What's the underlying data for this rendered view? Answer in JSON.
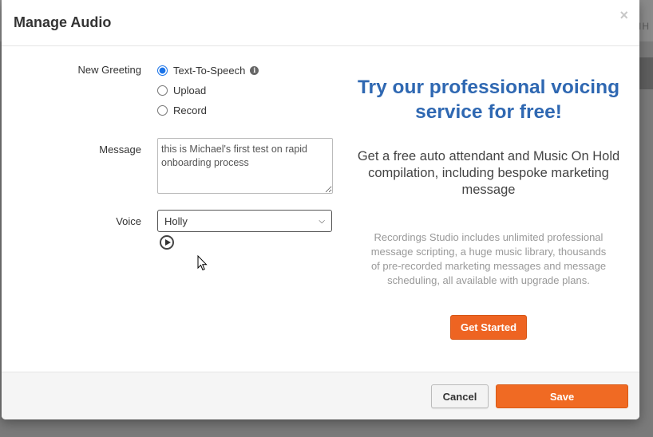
{
  "background": {
    "partial_text": "IH"
  },
  "modal": {
    "title": "Manage Audio",
    "close_glyph": "×"
  },
  "form": {
    "new_greeting_label": "New Greeting",
    "options": [
      {
        "label": "Text-To-Speech",
        "selected": true
      },
      {
        "label": "Upload",
        "selected": false
      },
      {
        "label": "Record",
        "selected": false
      }
    ],
    "info_glyph": "i",
    "message_label": "Message",
    "message_value": "this is Michael's first test on rapid onboarding process",
    "voice_label": "Voice",
    "voice_selected": "Holly"
  },
  "promo": {
    "title": "Try our professional voicing service for free!",
    "subtitle": "Get a free auto attendant and Music On Hold compilation, including bespoke marketing message",
    "description": "Recordings Studio includes unlimited professional message scripting, a huge music library, thousands of pre-recorded marketing messages and message scheduling, all available with upgrade plans.",
    "cta_label": "Get Started"
  },
  "footer": {
    "cancel_label": "Cancel",
    "save_label": "Save"
  },
  "colors": {
    "accent_orange": "#f06a23",
    "promo_blue": "#2f68b2"
  },
  "icons": {
    "info": "info-icon",
    "play": "play-icon",
    "close": "close-icon",
    "cursor": "mouse-cursor-icon"
  }
}
